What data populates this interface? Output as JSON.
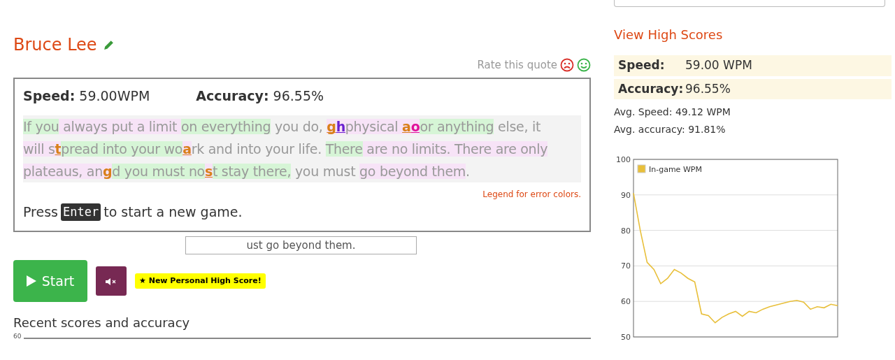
{
  "quote_author": "Bruce Lee",
  "rating": {
    "label": "Rate this quote"
  },
  "result": {
    "speed_label": "Speed:",
    "speed": "59.00WPM",
    "accuracy_label": "Accuracy:",
    "accuracy": "96.55%"
  },
  "quote_segments": [
    {
      "text": "If you",
      "kind": "fast"
    },
    {
      "text": " always put a limit ",
      "kind": "slow"
    },
    {
      "text": "on everything",
      "kind": "fast"
    },
    {
      "text": " you do, ",
      "kind": "plain"
    },
    {
      "text": "g",
      "kind": "error",
      "color": "#d9801a",
      "underlined": true
    },
    {
      "text": "h",
      "kind": "error",
      "color": "#6a1fd0",
      "underlined": true
    },
    {
      "text": "physical ",
      "kind": "slow"
    },
    {
      "text": "a",
      "kind": "error",
      "color": "#d9801a",
      "underlined": true
    },
    {
      "text": "o",
      "kind": "error",
      "color": "#e0119a",
      "underlined": true
    },
    {
      "text": "or anything",
      "kind": "fast"
    },
    {
      "text": " else, it ",
      "kind": "plain"
    },
    {
      "text": "will s",
      "kind": "slow"
    },
    {
      "text": "t",
      "kind": "error",
      "color": "#d9801a",
      "underlined": true
    },
    {
      "text": "pread into your wo",
      "kind": "fast"
    },
    {
      "text": "a",
      "kind": "error",
      "color": "#d9801a",
      "underlined": true
    },
    {
      "text": "rk and into your life. ",
      "kind": "plain"
    },
    {
      "text": "There",
      "kind": "fast"
    },
    {
      "text": " are no limits. There are ",
      "kind": "slow"
    },
    {
      "text": "only plateaus, an",
      "kind": "slow"
    },
    {
      "text": "g",
      "kind": "error",
      "color": "#d9801a",
      "underlined": false
    },
    {
      "text": "d you must no",
      "kind": "fast"
    },
    {
      "text": "s",
      "kind": "error",
      "color": "#d9801a",
      "underlined": true
    },
    {
      "text": "t stay there,",
      "kind": "fast"
    },
    {
      "text": " you must ",
      "kind": "plain"
    },
    {
      "text": "go beyond them",
      "kind": "slow"
    },
    {
      "text": ".",
      "kind": "plain"
    }
  ],
  "legend_link": "Legend for error colors.",
  "prompt": {
    "before": "Press",
    "key": "Enter",
    "after": "to start a new game."
  },
  "typing_field": {
    "value": "ust go beyond them."
  },
  "start_button": {
    "label": "Start"
  },
  "mute_button": {
    "muted": true
  },
  "high_score_badge": "★ New Personal High Score!",
  "recent_section": {
    "title": "Recent scores and accuracy",
    "tick_label": "60"
  },
  "sidebar": {
    "link": "View High Scores",
    "stats": [
      {
        "label": "Speed:",
        "value": "59.00 WPM"
      },
      {
        "label": "Accuracy:",
        "value": "96.55%"
      }
    ],
    "averages": [
      "Avg. Speed: 49.12 WPM",
      "Avg. accuracy: 91.81%"
    ],
    "chart_data": {
      "type": "line",
      "grid": true,
      "ylim": [
        50,
        100
      ],
      "yticks": [
        50,
        60,
        70,
        80,
        90,
        100
      ],
      "series": [
        {
          "name": "In-game WPM",
          "color": "#e8bf3a",
          "values": [
            90.5,
            80,
            71,
            69,
            65,
            66.5,
            69,
            68,
            66.5,
            65.5,
            56.5,
            56,
            54,
            55.5,
            56.5,
            57.2,
            55.8,
            57.2,
            56.8,
            57.8,
            58.5,
            59,
            59.5,
            60,
            60.3,
            59.8,
            57.8,
            58.5,
            58.2,
            59.2,
            58.8
          ]
        }
      ]
    }
  }
}
